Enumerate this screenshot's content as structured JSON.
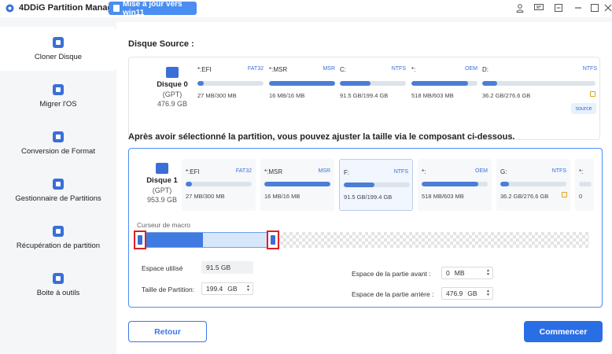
{
  "titlebar": {
    "app_title": "4DDiG Partition Manager",
    "upgrade_label": "Mise à jour vers win11",
    "icons": [
      "user-icon",
      "feedback-icon",
      "minimize-icon",
      "maximize-icon",
      "close-icon"
    ]
  },
  "sidebar": {
    "items": [
      {
        "label": "Cloner Disque",
        "icon": "clone-disk-icon",
        "active": true
      },
      {
        "label": "Migrer l'OS",
        "icon": "migrate-os-icon",
        "active": false
      },
      {
        "label": "Conversion de Format",
        "icon": "convert-icon",
        "active": false
      },
      {
        "label": "Gestionnaire de Partitions",
        "icon": "partition-manager-icon",
        "active": false
      },
      {
        "label": "Récupération de partition",
        "icon": "partition-recovery-icon",
        "active": false
      },
      {
        "label": "Boite à outils",
        "icon": "toolbox-icon",
        "active": false
      }
    ]
  },
  "source": {
    "title": "Disque Source :",
    "disk": {
      "name": "Disque 0",
      "style": "(GPT)",
      "size": "476.9 GB"
    },
    "partitions": [
      {
        "name": "*:EFI",
        "fs": "FAT32",
        "size": "27 MB/300 MB",
        "used": 0.09,
        "locked": false
      },
      {
        "name": "*:MSR",
        "fs": "MSR",
        "size": "16 MB/16 MB",
        "used": 1.0,
        "locked": false
      },
      {
        "name": "C:",
        "fs": "NTFS",
        "size": "91.5 GB/199.4 GB",
        "used": 0.46,
        "locked": false
      },
      {
        "name": "*:",
        "fs": "OEM",
        "size": "518 MB/603 MB",
        "used": 0.86,
        "locked": false
      },
      {
        "name": "D:",
        "fs": "NTFS",
        "size": "36.2 GB/276.6 GB",
        "used": 0.13,
        "locked": true
      }
    ],
    "badge": "source"
  },
  "target": {
    "title": "Après avoir sélectionné la partition, vous pouvez ajuster la taille via le composant ci-dessous.",
    "disk": {
      "name": "Disque 1",
      "style": "(GPT)",
      "size": "953.9 GB"
    },
    "partitions": [
      {
        "name": "*:EFI",
        "fs": "FAT32",
        "size": "27 MB/300 MB",
        "used": 0.09,
        "locked": false
      },
      {
        "name": "*:MSR",
        "fs": "MSR",
        "size": "16 MB/16 MB",
        "used": 1.0,
        "locked": false
      },
      {
        "name": "F:",
        "fs": "NTFS",
        "size": "91.5 GB/199.4 GB",
        "used": 0.46,
        "locked": false
      },
      {
        "name": "*:",
        "fs": "OEM",
        "size": "518 MB/603 MB",
        "used": 0.86,
        "locked": false
      },
      {
        "name": "G:",
        "fs": "NTFS",
        "size": "36.2 GB/276.6 GB",
        "used": 0.13,
        "locked": true
      },
      {
        "name": "*:",
        "fs": "",
        "size": "0 ",
        "used": 0,
        "locked": false
      }
    ],
    "macro_label": "Curseur de macro",
    "used_space_label": "Espace utilisé",
    "used_space_value": "91.5 GB",
    "partition_size_label": "Taille de Partition:",
    "partition_size_value": "199.4",
    "partition_size_unit": "GB",
    "before_space_label": "Espace de la partie avant :",
    "before_space_value": "0",
    "before_space_unit": "MB",
    "after_space_label": "Espace de la partie arrière :",
    "after_space_value": "476.9",
    "after_space_unit": "GB"
  },
  "actions": {
    "back_label": "Retour",
    "start_label": "Commencer"
  },
  "colors": {
    "accent": "#2a6ee6",
    "upgrade": "#4a8ef2",
    "lock": "#e2a020",
    "handle_highlight": "#e02020"
  }
}
